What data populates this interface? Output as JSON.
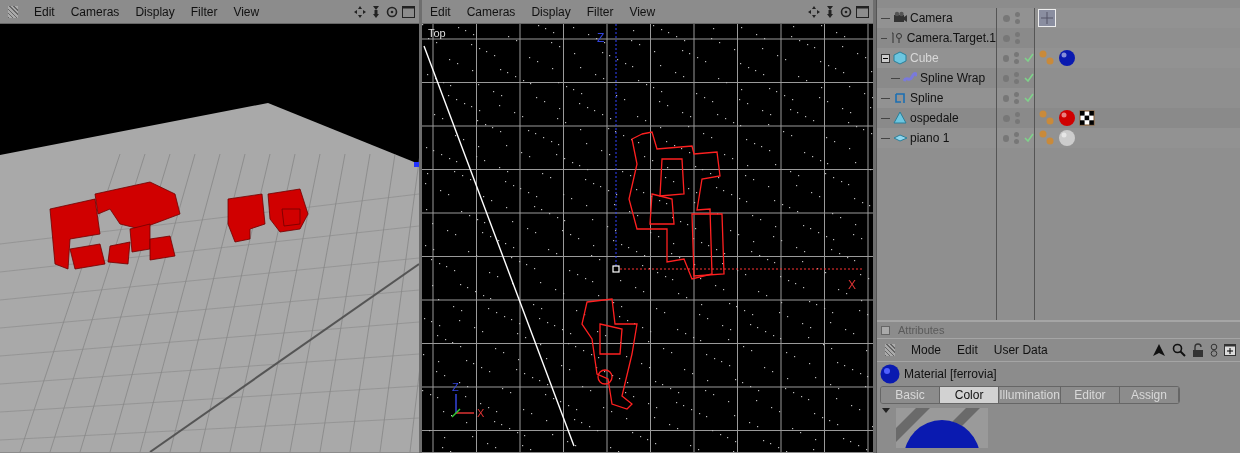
{
  "viewports": [
    {
      "menu": [
        "Edit",
        "Cameras",
        "Display",
        "Filter",
        "View"
      ],
      "kind": "perspective"
    },
    {
      "menu": [
        "Edit",
        "Cameras",
        "Display",
        "Filter",
        "View"
      ],
      "kind": "top",
      "label": "Top",
      "axis_labels": [
        {
          "text": "Z",
          "kind": "z"
        },
        {
          "text": "X",
          "kind": "x"
        }
      ],
      "corner_axis_labels": [
        {
          "text": "Z",
          "kind": "z"
        },
        {
          "text": "X",
          "kind": "x"
        }
      ]
    }
  ],
  "objects": [
    {
      "name": "Camera",
      "kind": "camera",
      "dimmed": false,
      "checked": false,
      "tags": [
        {
          "kind": "target"
        }
      ]
    },
    {
      "name": "Camera.Target.1",
      "kind": "null",
      "dimmed": false,
      "checked": false
    },
    {
      "name": "Cube",
      "kind": "cube",
      "dimmed": true,
      "checked": true,
      "expanded": true,
      "tags": [
        {
          "kind": "texture"
        },
        {
          "kind": "material",
          "color": "#0a1ab0"
        }
      ],
      "children": [
        {
          "name": "Spline Wrap",
          "kind": "deformer",
          "dimmed": false,
          "checked": true
        }
      ]
    },
    {
      "name": "Spline",
      "kind": "spline",
      "dimmed": false,
      "checked": true
    },
    {
      "name": "ospedale",
      "kind": "polygon",
      "dimmed": false,
      "checked": false,
      "tags": [
        {
          "kind": "texture"
        },
        {
          "kind": "material",
          "color": "#d00000"
        },
        {
          "kind": "checker"
        }
      ]
    },
    {
      "name": "piano 1",
      "kind": "plane",
      "dimmed": false,
      "checked": true,
      "tags": [
        {
          "kind": "texture"
        },
        {
          "kind": "material",
          "color": "#cccccc"
        }
      ]
    }
  ],
  "attributes": {
    "title": "Attributes",
    "menu": [
      "Mode",
      "Edit",
      "User Data"
    ],
    "object": "Material [ferrovia]",
    "tabs": [
      {
        "label": "Basic",
        "selected": false
      },
      {
        "label": "Color",
        "selected": true
      },
      {
        "label": "Illumination",
        "selected": false
      },
      {
        "label": "Editor",
        "selected": false
      },
      {
        "label": "Assign",
        "selected": false
      }
    ]
  }
}
